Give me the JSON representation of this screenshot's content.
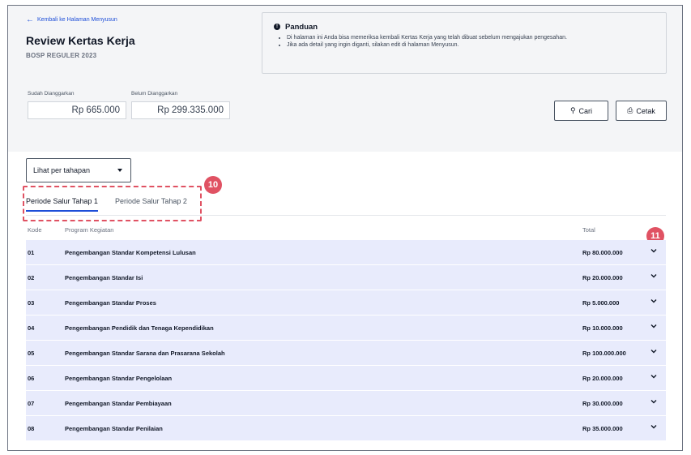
{
  "header": {
    "back_link": "Kembali ke Halaman Menyusun",
    "title": "Review Kertas Kerja",
    "subtitle": "BOSP REGULER 2023"
  },
  "guide": {
    "title": "Panduan",
    "items": [
      "Di halaman ini Anda bisa memeriksa kembali Kertas Kerja yang telah dibuat sebelum mengajukan pengesahan.",
      "Jika ada detail yang ingin diganti, silakan edit di halaman Menyusun."
    ]
  },
  "budget": {
    "allocated_label": "Sudah Dianggarkan",
    "allocated_value": "Rp 665.000",
    "unallocated_label": "Belum Dianggarkan",
    "unallocated_value": "Rp 299.335.000"
  },
  "toolbar": {
    "search_label": "Cari",
    "print_label": "Cetak"
  },
  "filter": {
    "selected": "Lihat per tahapan"
  },
  "tabs": [
    {
      "label": "Periode Salur Tahap 1",
      "active": true
    },
    {
      "label": "Periode Salur Tahap 2",
      "active": false
    }
  ],
  "markers": {
    "tabs": "10",
    "expand": "11"
  },
  "table": {
    "columns": [
      "Kode",
      "Program Kegiatan",
      "Total"
    ],
    "rows": [
      {
        "code": "01",
        "program": "Pengembangan Standar Kompetensi Lulusan",
        "total": "Rp 80.000.000"
      },
      {
        "code": "02",
        "program": "Pengembangan Standar Isi",
        "total": "Rp 20.000.000"
      },
      {
        "code": "03",
        "program": "Pengembangan Standar Proses",
        "total": "Rp 5.000.000"
      },
      {
        "code": "04",
        "program": "Pengembangan Pendidik dan Tenaga Kependidikan",
        "total": "Rp 10.000.000"
      },
      {
        "code": "05",
        "program": "Pengembangan Standar Sarana dan Prasarana Sekolah",
        "total": "Rp 100.000.000"
      },
      {
        "code": "06",
        "program": "Pengembangan Standar Pengelolaan",
        "total": "Rp 20.000.000"
      },
      {
        "code": "07",
        "program": "Pengembangan Standar Pembiayaan",
        "total": "Rp 30.000.000"
      },
      {
        "code": "08",
        "program": "Pengembangan Standar Penilaian",
        "total": "Rp 35.000.000"
      }
    ]
  },
  "colors": {
    "accent": "#1d4ed8",
    "marker": "#e05263",
    "row_bg": "#e8ebfc"
  }
}
